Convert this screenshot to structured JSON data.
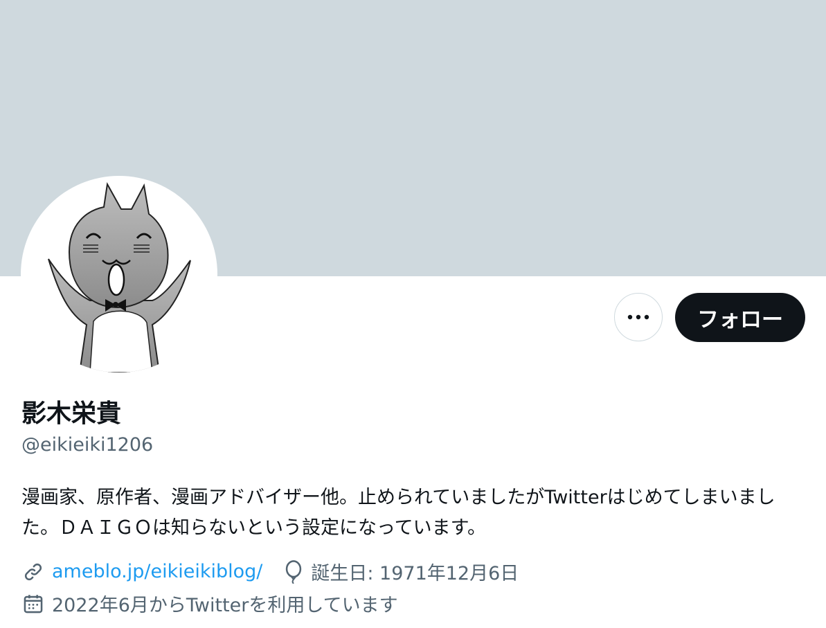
{
  "profile": {
    "display_name": "影木栄貴",
    "handle": "@eikieiki1206",
    "bio": "漫画家、原作者、漫画アドバイザー他。止められていましたがTwitterはじめてしまいました。ＤＡＩＧＯは知らないという設定になっています。",
    "website": "ameblo.jp/eikieikiblog/",
    "birthday": "誕生日: 1971年12月6日",
    "joined": "2022年6月からTwitterを利用しています"
  },
  "actions": {
    "follow_label": "フォロー"
  },
  "colors": {
    "banner": "#cfd9de",
    "link": "#1d9bf0",
    "secondary_text": "#536471",
    "primary_button": "#0f1419"
  },
  "icons": [
    "more-icon",
    "link-icon",
    "birthday-balloon-icon",
    "calendar-icon"
  ]
}
